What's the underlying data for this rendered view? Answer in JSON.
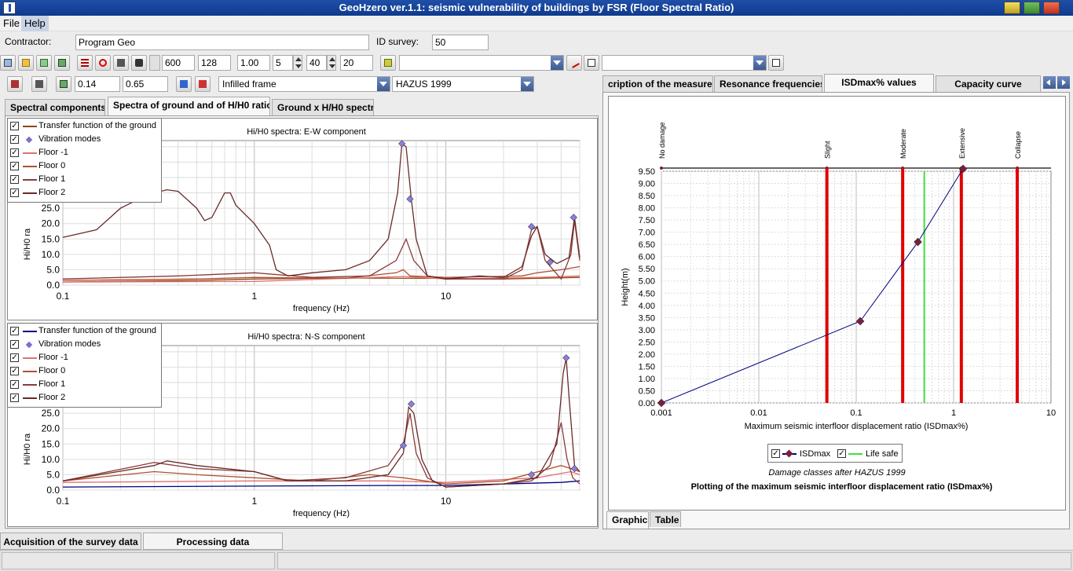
{
  "window": {
    "title": "GeoHzero ver.1.1: seismic vulnerability of buildings by FSR  (Floor Spectral Ratio)"
  },
  "menu": {
    "file": "File",
    "help": "Help"
  },
  "header": {
    "contractor_label": "Contractor:",
    "contractor_value": "Program Geo",
    "id_label": "ID survey:",
    "id_value": "50"
  },
  "toolbar": {
    "f1": "600",
    "f2": "128",
    "f3": "1.00",
    "f4": "5",
    "f5": "40",
    "f6": "20"
  },
  "toolbar2": {
    "v1": "0.14",
    "v2": "0.65",
    "structure": "Infilled frame",
    "code": "HAZUS 1999"
  },
  "left_tabs": [
    "Spectral components",
    "Spectra of ground and of H/H0 ratios",
    "Ground x H/H0 spectra"
  ],
  "right_tabs": [
    "cription of the measureme",
    "Resonance frequencies",
    "ISDmax% values",
    "Capacity curve"
  ],
  "colors": {
    "floor_m1": "#e07070",
    "floor0": "#b05030",
    "floor1": "#8a3a3a",
    "floor2": "#6a2a2a",
    "transfer_ew": "#8b4513",
    "transfer_ns": "#000080",
    "isd": "#000080",
    "damage": "#e00000",
    "lifesafe": "#40e040",
    "marker": "#7a1f3d"
  },
  "chart_data": [
    {
      "type": "line",
      "title": "Hi/H0 spectra: E-W component",
      "xlabel": "frequency (Hz)",
      "ylabel": "Hi/H0 ra",
      "xscale": "log",
      "xlim": [
        0.1,
        50
      ],
      "ylim": [
        0,
        47
      ],
      "x_ticks": [
        "0.1",
        "1",
        "10"
      ],
      "y_ticks": [
        "0.0",
        "5.0",
        "10.0",
        "15.0",
        "20.0",
        "25.0"
      ],
      "legend": [
        "Transfer function of the ground",
        "Vibration modes",
        "Floor -1",
        "Floor 0",
        "Floor 1",
        "Floor 2"
      ],
      "legend_position": "top-left",
      "series": [
        {
          "name": "Transfer function of the ground",
          "color": "#8b4513",
          "points": [
            [
              0.1,
              1
            ],
            [
              0.5,
              1.5
            ],
            [
              1,
              2
            ],
            [
              3,
              2.3
            ],
            [
              10,
              2.2
            ],
            [
              20,
              2
            ],
            [
              50,
              2.5
            ]
          ]
        },
        {
          "name": "Floor -1",
          "color": "#e07070",
          "points": [
            [
              0.1,
              1
            ],
            [
              1,
              1.2
            ],
            [
              6,
              2.8
            ],
            [
              10,
              2
            ],
            [
              30,
              2.5
            ],
            [
              50,
              3
            ]
          ]
        },
        {
          "name": "Floor 0",
          "color": "#b05030",
          "points": [
            [
              0.1,
              1.5
            ],
            [
              0.5,
              2
            ],
            [
              1,
              2.5
            ],
            [
              3,
              2.2
            ],
            [
              5.5,
              4
            ],
            [
              6,
              5
            ],
            [
              6.5,
              3
            ],
            [
              10,
              2.5
            ],
            [
              25,
              3
            ],
            [
              30,
              4
            ],
            [
              40,
              5
            ],
            [
              50,
              6
            ]
          ]
        },
        {
          "name": "Floor 1",
          "color": "#8a3a3a",
          "points": [
            [
              0.1,
              2
            ],
            [
              0.4,
              3
            ],
            [
              1,
              4
            ],
            [
              2,
              2.5
            ],
            [
              4,
              3
            ],
            [
              5.5,
              8
            ],
            [
              6.2,
              15
            ],
            [
              6.8,
              8
            ],
            [
              8,
              3
            ],
            [
              10,
              2
            ],
            [
              20,
              2
            ],
            [
              25,
              5
            ],
            [
              28,
              18
            ],
            [
              30,
              19
            ],
            [
              33,
              8
            ],
            [
              40,
              2
            ],
            [
              45,
              10
            ],
            [
              47,
              21
            ],
            [
              50,
              8
            ]
          ]
        },
        {
          "name": "Floor 2",
          "color": "#6a2a2a",
          "points": [
            [
              0.1,
              15.5
            ],
            [
              0.15,
              18
            ],
            [
              0.2,
              25
            ],
            [
              0.25,
              28
            ],
            [
              0.3,
              30
            ],
            [
              0.35,
              31
            ],
            [
              0.4,
              30.5
            ],
            [
              0.5,
              25
            ],
            [
              0.55,
              21
            ],
            [
              0.6,
              22
            ],
            [
              0.7,
              30
            ],
            [
              0.75,
              30
            ],
            [
              0.8,
              26
            ],
            [
              1,
              20
            ],
            [
              1.2,
              13
            ],
            [
              1.3,
              5
            ],
            [
              1.5,
              3
            ],
            [
              2,
              4
            ],
            [
              3,
              5
            ],
            [
              4,
              8
            ],
            [
              5,
              15
            ],
            [
              5.6,
              30
            ],
            [
              5.9,
              46
            ],
            [
              6.2,
              45
            ],
            [
              6.6,
              28
            ],
            [
              7,
              15
            ],
            [
              8,
              3
            ],
            [
              10,
              2
            ],
            [
              15,
              3
            ],
            [
              20,
              2.5
            ],
            [
              25,
              6
            ],
            [
              28,
              16
            ],
            [
              30,
              19
            ],
            [
              33,
              10
            ],
            [
              38,
              7
            ],
            [
              44,
              9
            ],
            [
              47,
              22
            ],
            [
              50,
              9
            ]
          ]
        }
      ],
      "modes": [
        [
          5.9,
          46
        ],
        [
          6.5,
          28
        ],
        [
          28,
          19
        ],
        [
          35,
          7.5
        ],
        [
          46.5,
          22
        ]
      ]
    },
    {
      "type": "line",
      "title": "Hi/H0 spectra: N-S component",
      "xlabel": "frequency (Hz)",
      "ylabel": "Hi/H0 ra",
      "xscale": "log",
      "xlim": [
        0.1,
        50
      ],
      "ylim": [
        0,
        47
      ],
      "x_ticks": [
        "0.1",
        "1",
        "10"
      ],
      "y_ticks": [
        "0.0",
        "5.0",
        "10.0",
        "15.0",
        "20.0",
        "25.0"
      ],
      "legend": [
        "Transfer function of the ground",
        "Vibration modes",
        "Floor -1",
        "Floor 0",
        "Floor 1",
        "Floor 2"
      ],
      "legend_position": "top-left",
      "series": [
        {
          "name": "Transfer function of the ground",
          "color": "#000080",
          "points": [
            [
              0.1,
              1
            ],
            [
              1,
              1.3
            ],
            [
              5,
              1.5
            ],
            [
              10,
              1.5
            ],
            [
              20,
              2
            ],
            [
              40,
              2.5
            ],
            [
              50,
              3
            ]
          ]
        },
        {
          "name": "Floor -1",
          "color": "#e07070",
          "points": [
            [
              0.1,
              2.5
            ],
            [
              1,
              3
            ],
            [
              5,
              3
            ],
            [
              10,
              2.5
            ],
            [
              30,
              4
            ],
            [
              45,
              6
            ],
            [
              50,
              5
            ]
          ]
        },
        {
          "name": "Floor 0",
          "color": "#b05030",
          "points": [
            [
              0.1,
              3
            ],
            [
              0.3,
              6
            ],
            [
              0.5,
              5
            ],
            [
              1,
              4
            ],
            [
              2,
              3
            ],
            [
              4,
              5
            ],
            [
              6,
              4
            ],
            [
              10,
              2
            ],
            [
              20,
              3
            ],
            [
              40,
              8
            ],
            [
              45,
              7
            ],
            [
              50,
              6
            ]
          ]
        },
        {
          "name": "Floor 1",
          "color": "#8a3a3a",
          "points": [
            [
              0.1,
              3
            ],
            [
              0.25,
              8
            ],
            [
              0.3,
              9
            ],
            [
              0.5,
              7
            ],
            [
              1,
              6
            ],
            [
              1.5,
              3
            ],
            [
              3,
              4
            ],
            [
              5,
              8
            ],
            [
              6,
              15
            ],
            [
              6.5,
              25
            ],
            [
              7,
              12
            ],
            [
              8,
              4
            ],
            [
              10,
              1
            ],
            [
              20,
              2
            ],
            [
              28,
              3
            ],
            [
              35,
              8
            ],
            [
              40,
              22
            ],
            [
              43,
              10
            ],
            [
              46,
              4
            ],
            [
              50,
              2
            ]
          ]
        },
        {
          "name": "Floor 2",
          "color": "#6a2a2a",
          "points": [
            [
              0.1,
              3
            ],
            [
              0.3,
              8
            ],
            [
              0.35,
              9.5
            ],
            [
              0.5,
              8
            ],
            [
              1,
              6
            ],
            [
              1.5,
              3
            ],
            [
              3,
              3
            ],
            [
              5,
              5
            ],
            [
              6,
              12
            ],
            [
              6.4,
              27
            ],
            [
              6.8,
              25
            ],
            [
              7.5,
              10
            ],
            [
              8.5,
              3
            ],
            [
              10,
              1
            ],
            [
              20,
              2
            ],
            [
              30,
              4
            ],
            [
              38,
              15
            ],
            [
              41,
              38
            ],
            [
              42.5,
              43
            ],
            [
              44,
              30
            ],
            [
              47,
              8
            ],
            [
              50,
              6
            ]
          ]
        }
      ],
      "modes": [
        [
          6,
          14.5
        ],
        [
          6.6,
          28
        ],
        [
          28,
          5
        ],
        [
          42.5,
          43
        ],
        [
          47,
          7
        ]
      ]
    },
    {
      "type": "line",
      "title": "Plotting of the maximum seismic interfloor displacement ratio (ISDmax%)",
      "subtitle": "Damage classes after HAZUS 1999",
      "xlabel": "Maximum seismic interfloor displacement ratio (ISDmax%)",
      "ylabel": "Height(m)",
      "xscale": "log",
      "xlim": [
        0.001,
        10
      ],
      "ylim": [
        0,
        9.5
      ],
      "x_ticks": [
        "0.001",
        "0.01",
        "0.1",
        "1",
        "10"
      ],
      "y_ticks": [
        "0.00",
        "0.50",
        "1.00",
        "1.50",
        "2.00",
        "2.50",
        "3.00",
        "3.50",
        "4.00",
        "4.50",
        "5.00",
        "5.50",
        "6.00",
        "6.50",
        "7.00",
        "7.50",
        "8.00",
        "8.50",
        "9.00",
        "9.50"
      ],
      "damage_classes": [
        {
          "label": "No damage",
          "x": 0.001
        },
        {
          "label": "Slight",
          "x": 0.05
        },
        {
          "label": "Moderate",
          "x": 0.3
        },
        {
          "label": "Extensive",
          "x": 1.2
        },
        {
          "label": "Collapse",
          "x": 4.5
        }
      ],
      "life_safe": 0.5,
      "series": [
        {
          "name": "ISDmax",
          "points": [
            [
              0.001,
              0
            ],
            [
              0.11,
              3.35
            ],
            [
              0.43,
              6.6
            ],
            [
              1.25,
              9.6
            ]
          ]
        }
      ],
      "legend": [
        "ISDmax",
        "Life safe"
      ],
      "legend_position": "bottom-center"
    }
  ],
  "right_bottom_tabs": [
    "Graphic",
    "Table"
  ],
  "bottom_tabs": [
    "Acquisition of the survey data",
    "Processing data"
  ]
}
